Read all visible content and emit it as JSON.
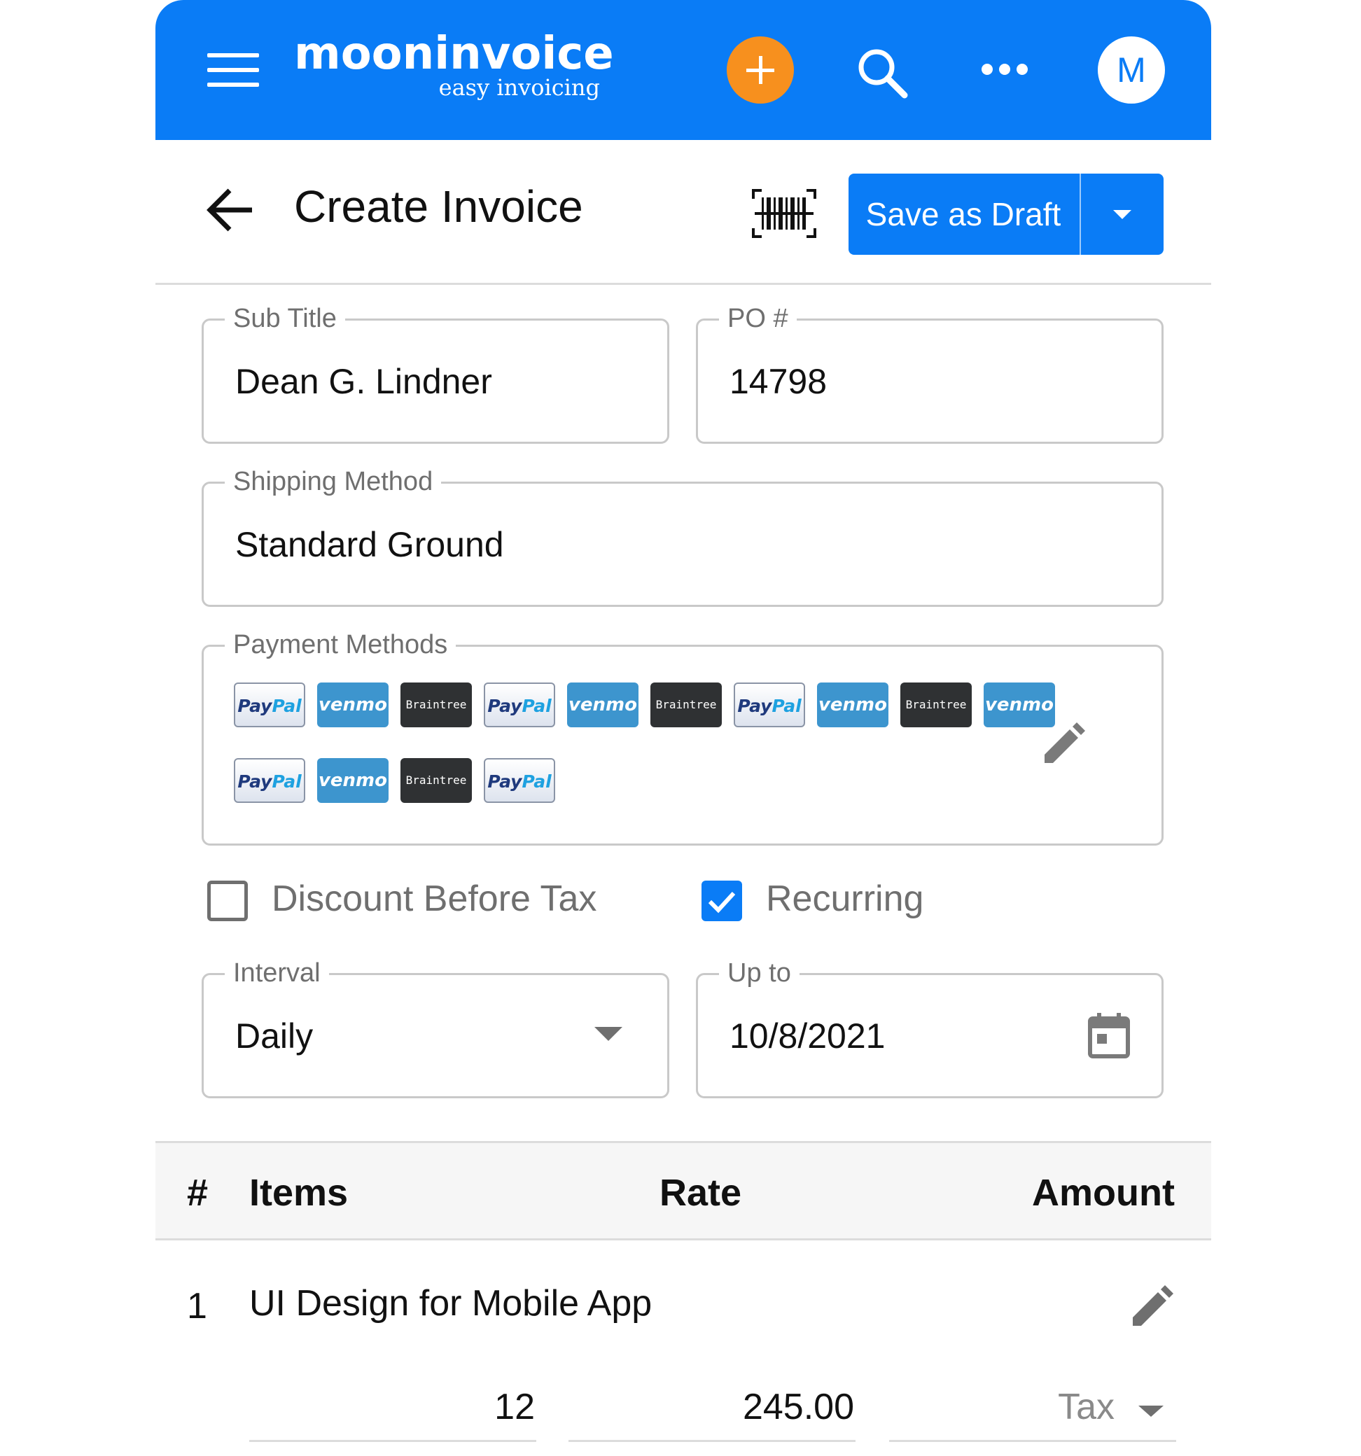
{
  "app": {
    "logo_main": "mooninvoice",
    "logo_sub": "easy invoicing",
    "avatar_initial": "M",
    "brand_color": "#0a7cf6",
    "accent_color": "#f7901e"
  },
  "header": {
    "title": "Create Invoice",
    "save_label": "Save as Draft"
  },
  "fields": {
    "sub_title": {
      "label": "Sub Title",
      "value": "Dean G. Lindner"
    },
    "po": {
      "label": "PO #",
      "value": "14798"
    },
    "shipping": {
      "label": "Shipping Method",
      "value": "Standard Ground"
    },
    "payment": {
      "label": "Payment Methods"
    },
    "interval": {
      "label": "Interval",
      "value": "Daily"
    },
    "up_to": {
      "label": "Up to",
      "value": "10/8/2021"
    }
  },
  "payment_methods": [
    "PayPal",
    "venmo",
    "Braintree",
    "PayPal",
    "venmo",
    "Braintree",
    "PayPal",
    "venmo",
    "Braintree",
    "venmo",
    "PayPal",
    "venmo",
    "Braintree",
    "PayPal"
  ],
  "options": {
    "discount_before_tax": {
      "label": "Discount Before Tax",
      "checked": false
    },
    "recurring": {
      "label": "Recurring",
      "checked": true
    }
  },
  "table": {
    "headers": {
      "num": "#",
      "items": "Items",
      "rate": "Rate",
      "amount": "Amount"
    },
    "rows": [
      {
        "num": "1",
        "description": "UI Design for Mobile App",
        "qty": "12",
        "rate": "245.00",
        "tax": "Tax"
      }
    ]
  }
}
